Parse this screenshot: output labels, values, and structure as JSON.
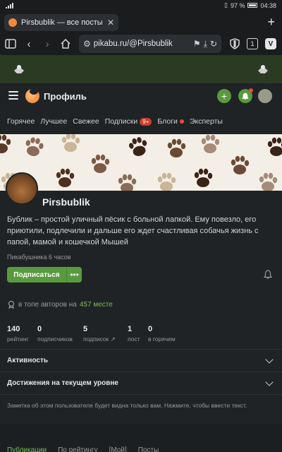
{
  "status_bar": {
    "battery": "97 %",
    "time": "04:38"
  },
  "browser": {
    "tab_title": "Pirsbublik — все посты пользователя",
    "url": "pikabu.ru/@Pirsbublik",
    "tab_count": "1",
    "vivaldi_letter": "V"
  },
  "site": {
    "header_title": "Профиль",
    "nav": [
      {
        "label": "Горячее"
      },
      {
        "label": "Лучшее"
      },
      {
        "label": "Свежее"
      },
      {
        "label": "Подписки",
        "badge": "9+"
      },
      {
        "label": "Блоги",
        "dot": true
      },
      {
        "label": "Эксперты"
      }
    ]
  },
  "profile": {
    "username": "Pirsbublik",
    "bio": "Бублик – простой уличный пёсик с больной лапкой. Ему повезло, его приютили, подлечили и дальше его ждет счастливая собачья жизнь с папой, мамой и кошечкой Мышей",
    "since": "Пикабушника 6 часов",
    "subscribe_label": "Подписаться",
    "more_label": "•••",
    "rank_prefix": "в топе авторов на",
    "rank_value": "457 месте",
    "stats": [
      {
        "num": "140",
        "label": "рейтинг"
      },
      {
        "num": "0",
        "label": "подписчиков"
      },
      {
        "num": "5",
        "label": "подписок ↗"
      },
      {
        "num": "1",
        "label": "пост"
      },
      {
        "num": "0",
        "label": "в горячем"
      }
    ],
    "activity_label": "Активность",
    "achievements_label": "Достижения на текущем уровне",
    "note": "Заметка об этом пользователе будет видна только вам. Нажмите, чтобы ввести текст."
  },
  "bottom_tabs": [
    "Публикации",
    "По рейтингу",
    "[Мой]",
    "Посты"
  ],
  "colors": {
    "accent_green": "#5a9a3e",
    "rank_green": "#7dbb57",
    "badge_red": "#c8402f"
  }
}
